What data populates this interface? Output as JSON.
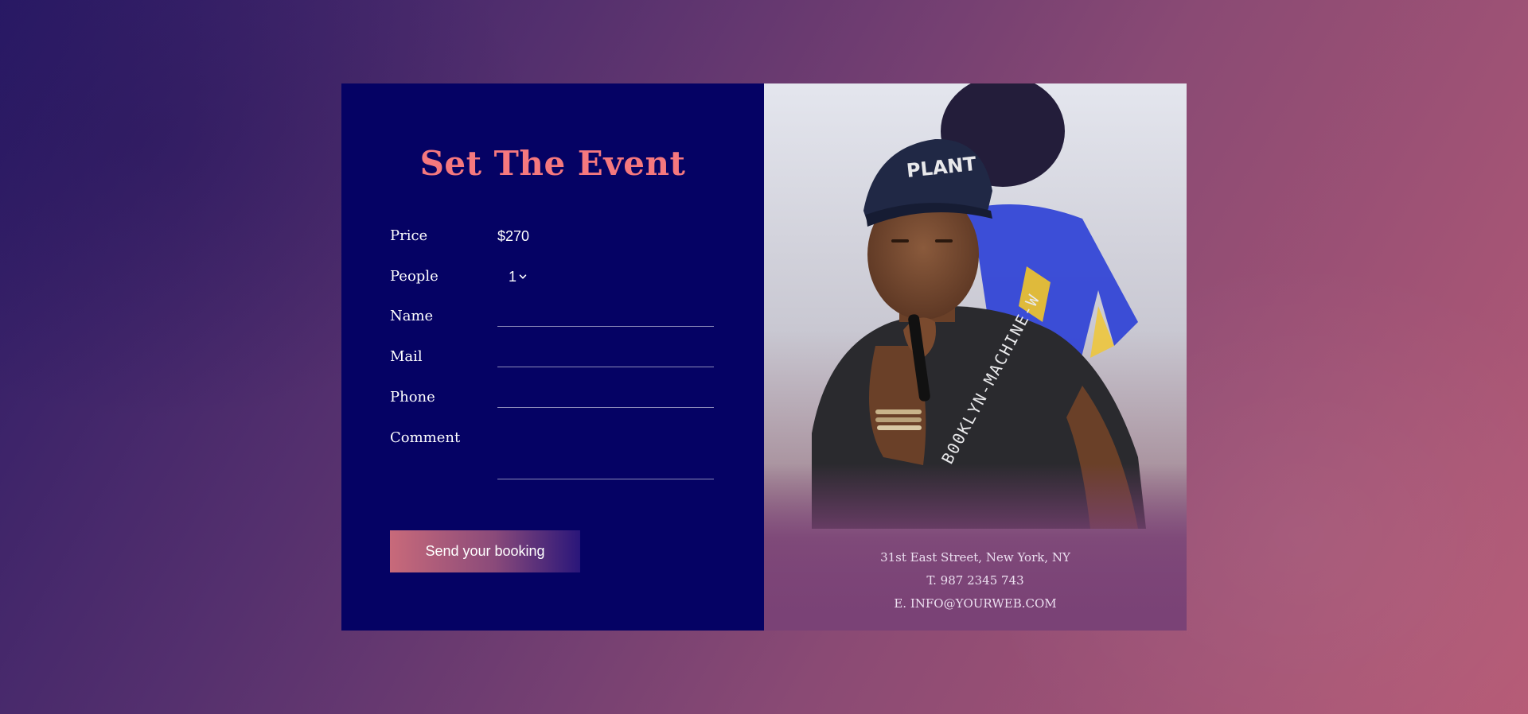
{
  "form": {
    "title": "Set The Event",
    "price_label": "Price",
    "price_value": "$270",
    "people_label": "People",
    "people_value": "1",
    "name_label": "Name",
    "name_value": "",
    "mail_label": "Mail",
    "mail_value": "",
    "phone_label": "Phone",
    "phone_value": "",
    "comment_label": "Comment",
    "comment_value": "",
    "submit_label": "Send your booking"
  },
  "contact": {
    "address": "31st East Street, New York, NY",
    "phone": "T. 987 2345 743",
    "email": "E. INFO@YOURWEB.COM"
  },
  "icons": {
    "people_dropdown": "chevron-down-icon"
  },
  "colors": {
    "form_background": "#050264",
    "title_accent": "#f5787e",
    "button_gradient_start": "#c86a7a",
    "button_gradient_end": "#2a167a",
    "underline": "#8a89b8",
    "photo_overlay": "#7a4276"
  }
}
